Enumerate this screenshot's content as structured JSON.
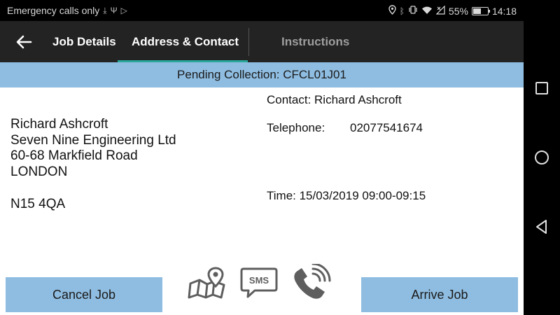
{
  "status_bar": {
    "carrier_text": "Emergency calls only",
    "battery_percent": "55%",
    "battery_level": 0.55,
    "time": "14:18",
    "left_icons": [
      "download-icon",
      "usb-icon",
      "play-store-icon"
    ],
    "right_icons": [
      "location-icon",
      "bluetooth-icon",
      "vibrate-icon",
      "wifi-icon",
      "no-signal-icon"
    ]
  },
  "app_bar": {
    "tabs": [
      {
        "label": "Job Details"
      },
      {
        "label": "Address & Contact",
        "selected": true
      },
      {
        "label": "Instructions"
      }
    ],
    "accent_color": "#2aa79b"
  },
  "status_band": {
    "text": "Pending Collection: CFCL01J01",
    "color": "#8fbde1"
  },
  "address": {
    "lines": [
      "Richard Ashcroft",
      "Seven Nine Engineering Ltd",
      "60-68 Markfield Road",
      "LONDON"
    ],
    "postcode": "N15 4QA"
  },
  "contact": {
    "contact_line": "Contact: Richard Ashcroft",
    "telephone_label": "Telephone:",
    "telephone_value": "02077541674",
    "time_line": "Time: 15/03/2019 09:00-09:15"
  },
  "actions": {
    "cancel_label": "Cancel Job",
    "arrive_label": "Arrive Job",
    "sms_label": "SMS",
    "icons": [
      "map-icon",
      "sms-icon",
      "phone-call-icon"
    ]
  },
  "nav_bar": {
    "icons": [
      "recents-icon",
      "home-icon",
      "back-icon"
    ]
  }
}
